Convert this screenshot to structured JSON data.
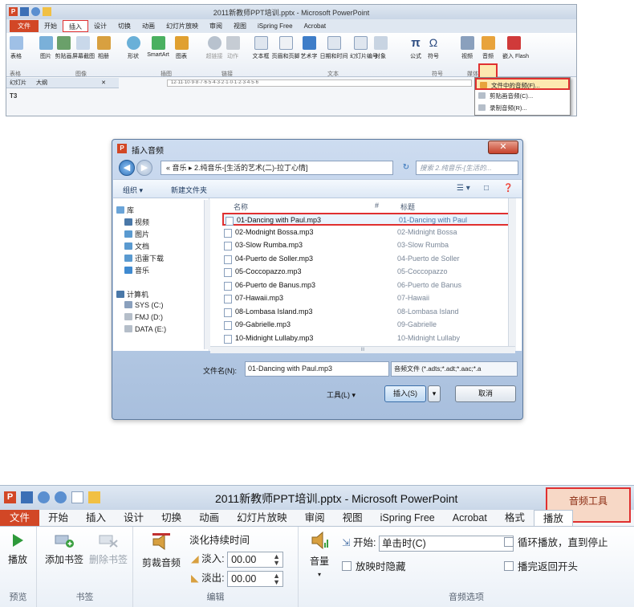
{
  "panel1": {
    "title": "2011新教师PPT培训.pptx - Microsoft PowerPoint",
    "tabs": [
      "文件",
      "开始",
      "插入",
      "设计",
      "切换",
      "动画",
      "幻灯片放映",
      "审阅",
      "视图",
      "iSpring Free",
      "Acrobat"
    ],
    "active_tab": "插入",
    "buttons": [
      "表格",
      "图片",
      "剪贴画",
      "屏幕截图",
      "相册",
      "形状",
      "SmartArt",
      "图表",
      "超链接",
      "动作",
      "文本框",
      "页眉和页脚",
      "艺术字",
      "日期和时间",
      "幻灯片编号",
      "对象",
      "公式",
      "符号",
      "视频",
      "音频",
      "嵌入 Flash"
    ],
    "groups": [
      "表格",
      "图像",
      "插图",
      "链接",
      "文本",
      "符号",
      "媒体"
    ],
    "dropdown_items": [
      "文件中的音频(F)...",
      "剪贴画音频(C)...",
      "录制音频(R)..."
    ],
    "slides_tab": [
      "幻灯片",
      "大纲"
    ],
    "thumb_label": "T3",
    "ruler_text": "12·11·10·9·8·7·6·5·4·3·2·1·0·1·2·3·4·5·6"
  },
  "dialog": {
    "title": "插入音频",
    "address": "« 音乐 ▸ 2.纯音乐-[生活的艺术(二)-拉丁心情]",
    "search_placeholder": "搜索 2.纯音乐-[生活的...",
    "toolbar": {
      "organize": "组织 ▾",
      "new_folder": "新建文件夹"
    },
    "nav": [
      {
        "label": "库",
        "color": "#6aa4d8"
      },
      {
        "label": "视频",
        "color": "#4a78a8"
      },
      {
        "label": "图片",
        "color": "#5a9ad0"
      },
      {
        "label": "文档",
        "color": "#5a9ad0"
      },
      {
        "label": "迅雷下载",
        "color": "#5a9ad0"
      },
      {
        "label": "音乐",
        "color": "#3f8ad0"
      },
      {
        "label": "计算机",
        "color": "#4a78a8"
      },
      {
        "label": "SYS (C:)",
        "color": "#8aa0bd"
      },
      {
        "label": "FMJ (D:)",
        "color": "#b5bec9"
      },
      {
        "label": "DATA (E:)",
        "color": "#b5bec9"
      }
    ],
    "columns": {
      "name": "名称",
      "num": "#",
      "title": "标题"
    },
    "files": [
      {
        "name": "01-Dancing with Paul.mp3",
        "title": "01-Dancing with Paul",
        "selected": true
      },
      {
        "name": "02-Modnight Bossa.mp3",
        "title": "02-Midnight Bossa"
      },
      {
        "name": "03-Slow Rumba.mp3",
        "title": "03-Slow Rumba"
      },
      {
        "name": "04-Puerto de Soller.mp3",
        "title": "04-Puerto de Soller"
      },
      {
        "name": "05-Coccopazzo.mp3",
        "title": "05-Coccopazzo"
      },
      {
        "name": "06-Puerto de Banus.mp3",
        "title": "06-Puerto de Banus"
      },
      {
        "name": "07-Hawaii.mp3",
        "title": "07-Hawaii"
      },
      {
        "name": "08-Lombasa Island.mp3",
        "title": "08-Lombasa Island"
      },
      {
        "name": "09-Gabrielle.mp3",
        "title": "09-Gabrielle"
      },
      {
        "name": "10-Midnight Lullaby.mp3",
        "title": "10-Midnight Lullaby"
      }
    ],
    "filename_label": "文件名(N):",
    "filename_value": "01-Dancing with Paul.mp3",
    "filetype": "音频文件 (*.adts;*.adt;*.aac;*.a",
    "tools_label": "工具(L) ▾",
    "insert_label": "插入(S)",
    "cancel_label": "取消"
  },
  "panel3": {
    "title": "2011新教师PPT培训.pptx - Microsoft PowerPoint",
    "context_title": "音频工具",
    "tabs": [
      "文件",
      "开始",
      "插入",
      "设计",
      "切换",
      "动画",
      "幻灯片放映",
      "审阅",
      "视图",
      "iSpring Free",
      "Acrobat",
      "格式",
      "播放"
    ],
    "selected_tab": "播放",
    "play": "播放",
    "preview_group": "预览",
    "add_bookmark": "添加书签",
    "remove_bookmark": "删除书签",
    "bookmark_group": "书签",
    "trim_audio": "剪裁音频",
    "fade_duration": "淡化持续时间",
    "fade_in_label": "淡入:",
    "fade_in_value": "00.00",
    "fade_out_label": "淡出:",
    "fade_out_value": "00.00",
    "edit_group": "编辑",
    "volume": "音量",
    "start_label": "开始:",
    "start_value": "单击时(C)",
    "hide_label": "放映时隐藏",
    "loop_label": "循环播放，直到停止",
    "rewind_label": "播完返回开头",
    "audio_options_group": "音频选项"
  }
}
